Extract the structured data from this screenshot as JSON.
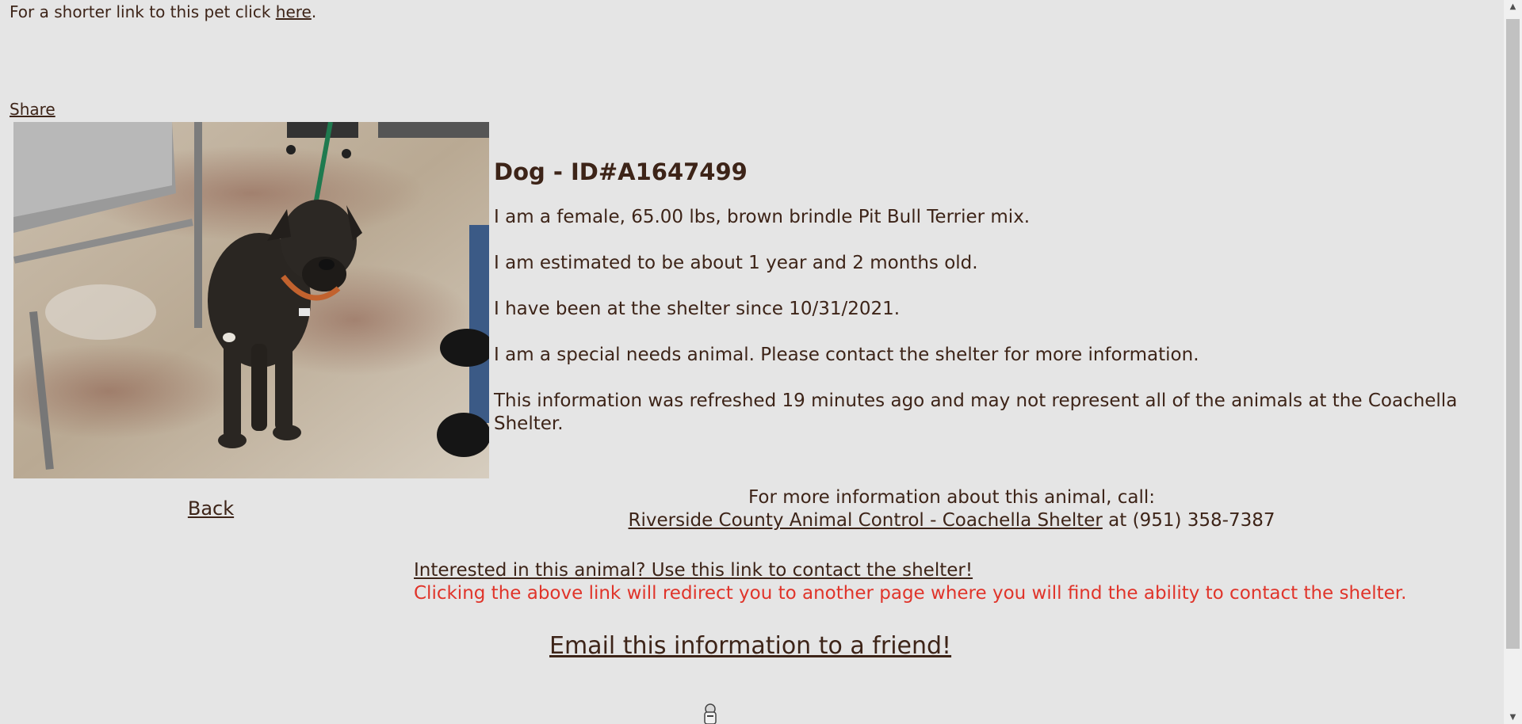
{
  "header": {
    "shortlink_prefix": "For a shorter link to this pet click ",
    "shortlink_link": "here",
    "shortlink_suffix": ".",
    "share": "Share"
  },
  "animal": {
    "title": "Dog - ID#A1647499",
    "description": "I am a female, 65.00 lbs, brown brindle Pit Bull Terrier mix.",
    "age": "I am estimated to be about 1 year and 2 months old.",
    "since": "I have been at the shelter since 10/31/2021.",
    "special_needs": "I am a special needs animal. Please contact the shelter for more information.",
    "refreshed": "This information was refreshed 19 minutes ago and may not represent all of the animals at the Coachella Shelter."
  },
  "nav": {
    "back": "Back"
  },
  "contact": {
    "intro": "For more information about this animal, call:",
    "shelter_link": "Riverside County Animal Control - Coachella Shelter",
    "phone": " at (951) 358-7387",
    "interested_link": "Interested in this animal? Use this link to contact the shelter!",
    "redirect_notice": "Clicking the above link will redirect you to another page where you will find the ability to contact the shelter.",
    "email_link": "Email this information to a friend!"
  },
  "colors": {
    "background": "#e5e5e5",
    "text": "#3d2418",
    "warning": "#e0342a"
  },
  "icons": {
    "scroll_up": "scroll-up-arrow-icon",
    "scroll_down": "scroll-down-arrow-icon",
    "loading": "loading-spinner-icon"
  }
}
